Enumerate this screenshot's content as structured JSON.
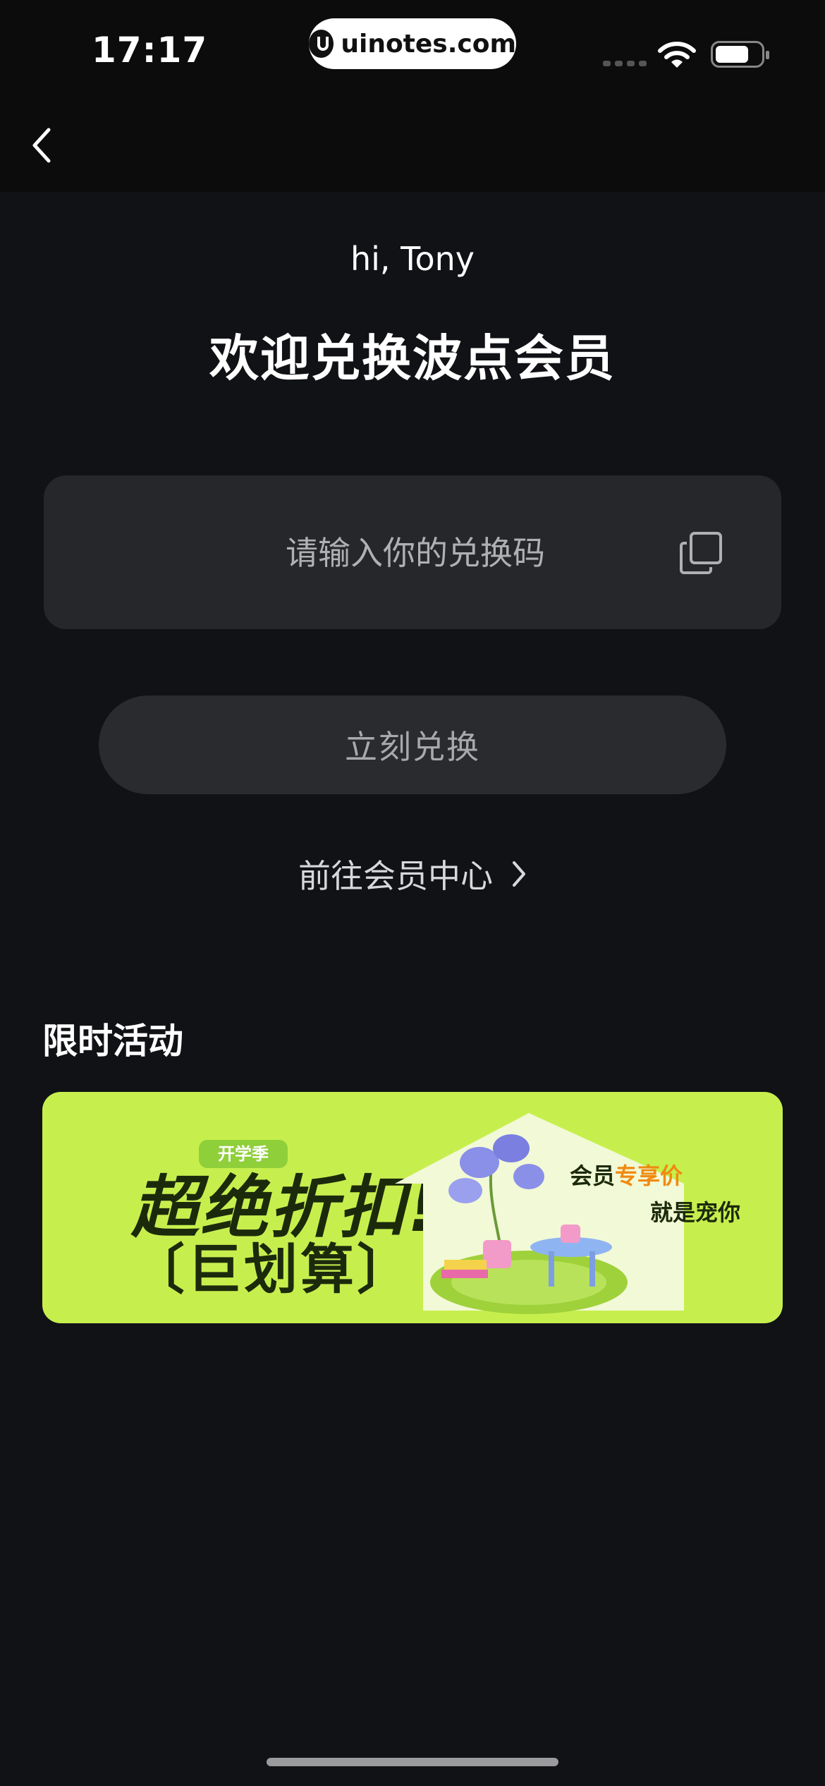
{
  "status": {
    "time": "17:17",
    "url": "uinotes.com"
  },
  "page": {
    "greeting": "hi, Tony",
    "title": "欢迎兑换波点会员"
  },
  "redeem": {
    "placeholder": "请输入你的兑换码",
    "button_label": "立刻兑换"
  },
  "member_center_link": "前往会员中心",
  "promo": {
    "section_title": "限时活动",
    "banner": {
      "tag": "开学季",
      "headline": "超绝折扣!",
      "subheadline": "〔巨划算〕",
      "member_text": "会员",
      "member_accent": "专享价",
      "pet_text": "就是宠你",
      "background_color": "#c6ef4e"
    }
  }
}
